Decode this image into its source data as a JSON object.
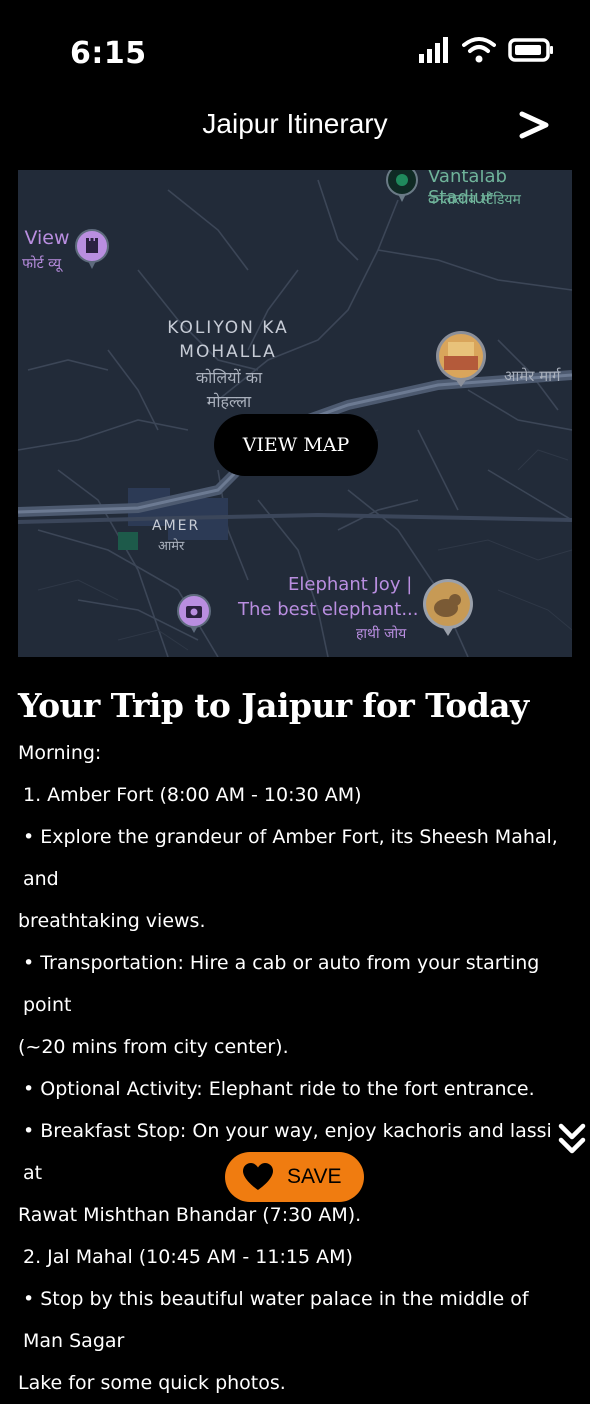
{
  "status_bar": {
    "time": "6:15"
  },
  "header": {
    "title": "Jaipur Itinerary"
  },
  "map": {
    "view_map_label": "VIEW MAP",
    "labels": {
      "stadium": "Vantalab Stadiur",
      "stadium_hindi": "वनतालाब स्टेडियम",
      "view": ": View",
      "view_hindi": "र फोर्ट व्यू",
      "area1_line1": "KOLIYON KA",
      "area1_line2": "MOHALLA",
      "area1_hindi_line1": "कोलियों का",
      "area1_hindi_line2": "मोहल्ला",
      "road": "आमेर मार्ग",
      "area2": "AMER",
      "area2_hindi": "आमेर",
      "elephant_line1": "Elephant Joy |",
      "elephant_line2": "The best elephant...",
      "elephant_hindi": "हाथी जोय"
    },
    "colors": {
      "background": "#222b39",
      "poi_purple": "#b98ee0",
      "poi_green": "#1f8a5c"
    }
  },
  "trip": {
    "title": "Your Trip to Jaipur for Today",
    "lines": [
      "Morning:",
      " 1. Amber Fort (8:00 AM - 10:30 AM)",
      " • Explore the grandeur of Amber Fort, its Sheesh Mahal, and",
      "breathtaking views.",
      " • Transportation: Hire a cab or auto from your starting point",
      "(~20 mins from city center).",
      " • Optional Activity: Elephant ride to the fort entrance.",
      " • Breakfast Stop: On your way, enjoy kachoris and lassi at",
      "Rawat Mishthan Bhandar (7:30 AM).",
      " 2. Jal Mahal (10:45 AM - 11:15 AM)",
      " • Stop by this beautiful water palace in the middle of Man Sagar",
      "Lake for some quick photos."
    ]
  },
  "save": {
    "label": "SAVE",
    "color": "#f07c10"
  },
  "icons": [
    "signal-icon",
    "wifi-icon",
    "battery-icon",
    "forward-arrow-icon",
    "double-chevron-down-icon",
    "heart-icon"
  ]
}
